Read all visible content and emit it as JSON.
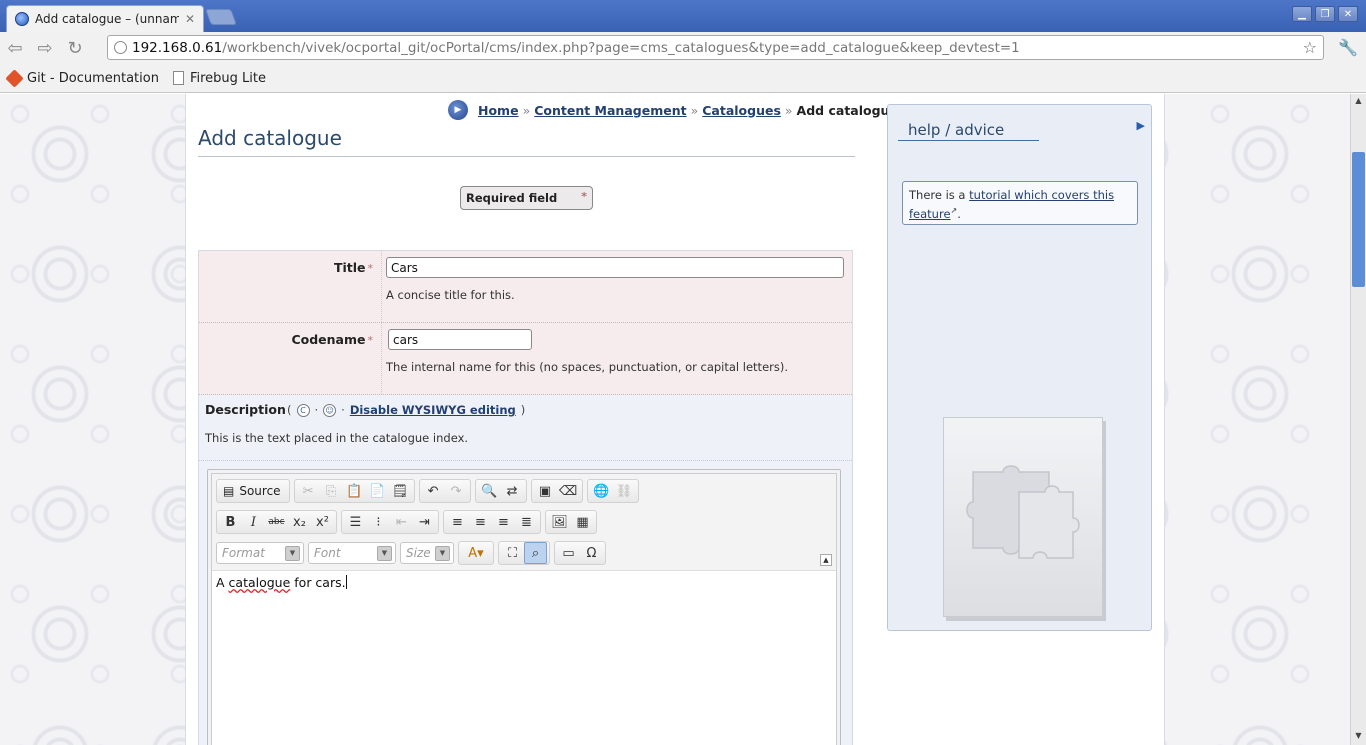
{
  "browser": {
    "tab_title": "Add catalogue – (unnamed",
    "tab_close": "✕",
    "url_host": "192.168.0.61",
    "url_path": "/workbench/vivek/ocportal_git/ocPortal/cms/index.php?page=cms_catalogues&type=add_catalogue&keep_devtest=1",
    "bookmarks": [
      {
        "label": "Git - Documentation"
      },
      {
        "label": "Firebug Lite"
      }
    ]
  },
  "breadcrumb": {
    "home": "Home",
    "content_management": "Content Management",
    "catalogues": "Catalogues",
    "current": "Add catalogue",
    "separator": "»"
  },
  "page": {
    "title": "Add catalogue",
    "required_field_label": "Required field",
    "required_marker": "*"
  },
  "form": {
    "title": {
      "label": "Title",
      "value": "Cars",
      "hint": "A concise title for this."
    },
    "codename": {
      "label": "Codename",
      "value": "cars",
      "hint": "The internal name for this (no spaces, punctuation, or capital letters)."
    },
    "description": {
      "label": "Description",
      "open_paren": "(",
      "dot": "·",
      "close_paren": ")",
      "wysiwyg_link": "Disable WYSIWYG editing",
      "hint": "This is the text placed in the catalogue index."
    }
  },
  "editor": {
    "source_label": "Source",
    "format_placeholder": "Format",
    "font_placeholder": "Font",
    "size_placeholder": "Size",
    "content_prefix": "A ",
    "content_misspelled": "catalogue",
    "content_suffix": " for cars."
  },
  "help": {
    "title": "help / advice",
    "text_prefix": "There is a ",
    "link_text": "tutorial which covers this feature",
    "text_suffix": "."
  },
  "colors": {
    "title_bar": "#3a62b4",
    "link": "#23406e",
    "required_row_bg": "#f6eced",
    "help_bg": "#e9eef6"
  }
}
